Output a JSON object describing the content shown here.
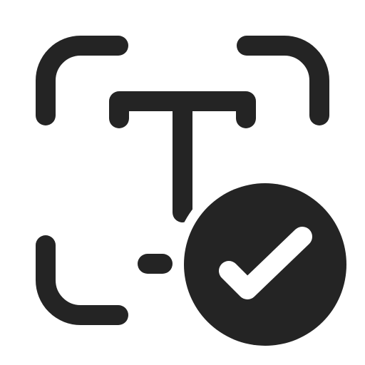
{
  "icon": {
    "name": "text-scan-check-icon",
    "color": "#242424",
    "background": "#ffffff",
    "parts": {
      "frame": "scan-frame-corners",
      "glyph": "text-t-glyph",
      "badge": "checkmark-circle-badge"
    }
  }
}
